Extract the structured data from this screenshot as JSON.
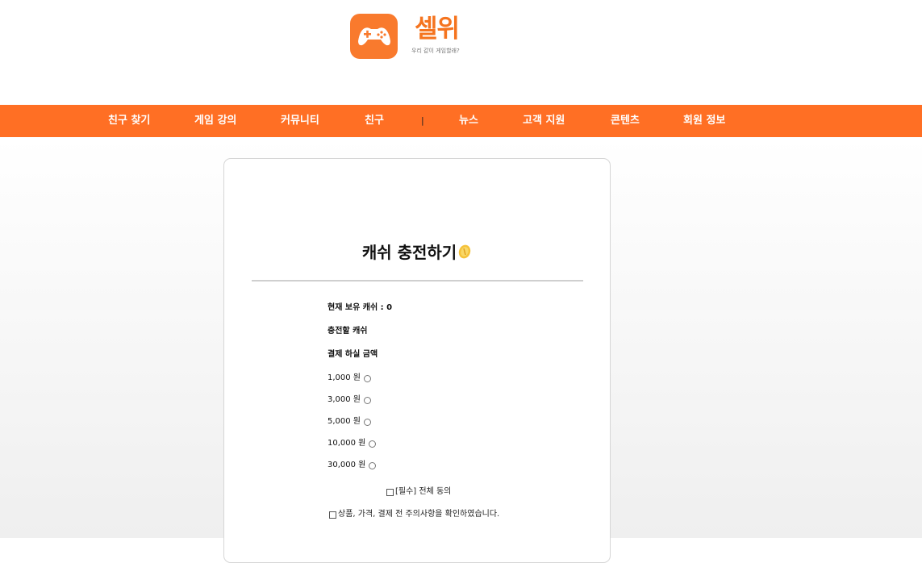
{
  "brand": {
    "name": "셀위",
    "tagline": "우리 같이 게임할래?",
    "logo_icon": "gamepad-icon",
    "accent_color": "#ff6f24"
  },
  "nav": {
    "items": [
      "친구 찾기",
      "게임 강의",
      "커뮤니티",
      "친구",
      "뉴스",
      "고객 지원",
      "콘텐츠",
      "회원 정보"
    ],
    "separator": "|"
  },
  "charge": {
    "title": "캐쉬 충전하기",
    "title_icon": "coin-icon",
    "current_label": "현재 보유 캐쉬 : 0",
    "charge_label": "충전할 캐쉬",
    "payment_label": "결제 하실 금액",
    "options": [
      "1,000 원",
      "3,000 원",
      "5,000 원",
      "10,000 원",
      "30,000 원"
    ],
    "agree_all": "[필수] 전체 동의",
    "agree_confirm": "상품, 가격, 결제 전 주의사항을 확인하였습니다."
  }
}
